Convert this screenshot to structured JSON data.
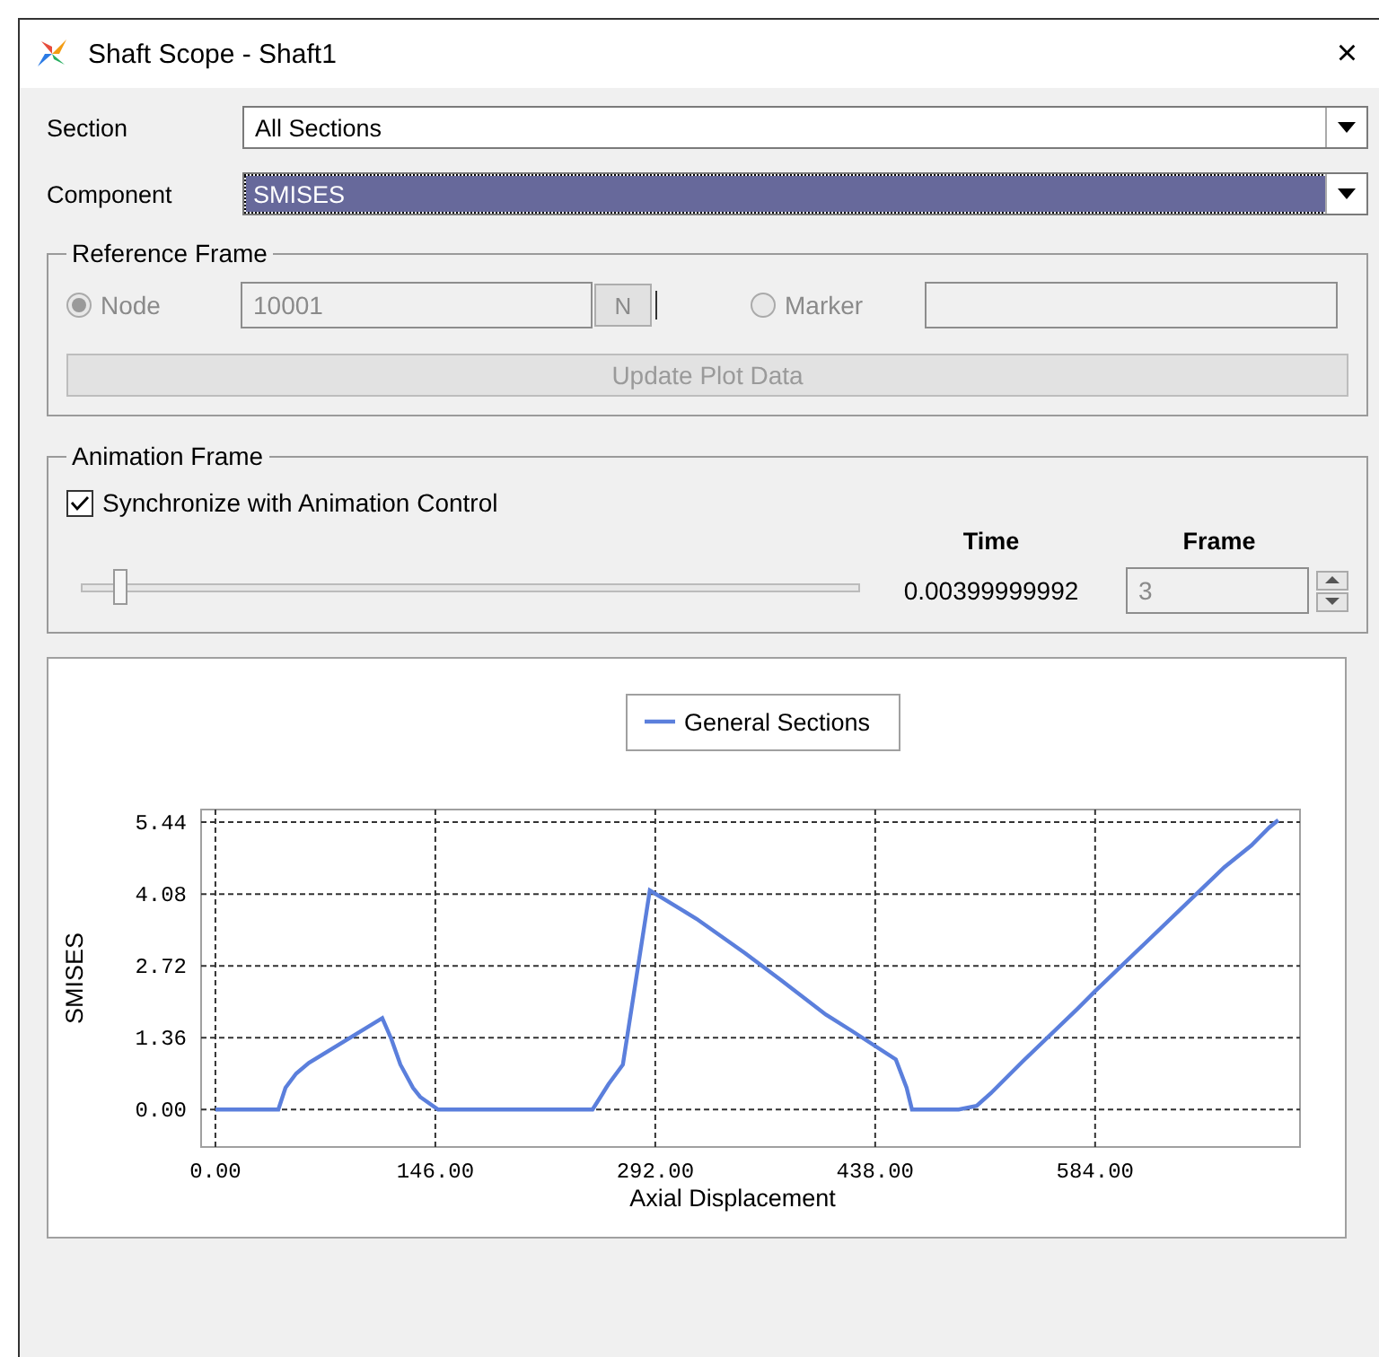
{
  "window": {
    "title": "Shaft Scope - Shaft1",
    "close": "×"
  },
  "fields": [
    {
      "label": "Section",
      "value": "All Sections",
      "selected": false
    },
    {
      "label": "Component",
      "value": "SMISES",
      "selected": true
    }
  ],
  "reference_frame": {
    "title": "Reference Frame",
    "disabled": true,
    "options": [
      {
        "label": "Node",
        "selected": true,
        "value": "10001",
        "button": "N"
      },
      {
        "label": "Marker",
        "selected": false
      }
    ],
    "update_button": "Update Plot Data"
  },
  "animation_frame": {
    "title": "Animation Frame",
    "sync": {
      "label": "Synchronize with Animation Control",
      "checked": true
    },
    "slider": {
      "level": 0.048
    },
    "time_label": "Time",
    "time_value": "0.00399999992",
    "frame_label": "Frame",
    "frame_value": "3"
  },
  "chart": {
    "chart_data": {
      "type": "line",
      "grid": true,
      "xlabel": "Axial Displacement",
      "ylabel": "SMISES",
      "x": [
        0,
        41.7,
        46.5,
        53.6,
        62,
        110.8,
        116.8,
        122.8,
        131.1,
        135.9,
        147.8,
        250.3,
        261,
        270.5,
        288.4,
        319.4,
        351.6,
        375.4,
        405.2,
        421.9,
        451.7,
        458.8,
        462.4,
        493.4,
        505.3,
        514.9,
        536.3,
        572.1,
        584,
        669.8,
        687.7,
        699.6,
        705.6
      ],
      "series": [
        {
          "name": "General Sections",
          "color": "#5b7fdc",
          "values": [
            0,
            0,
            0.41,
            0.68,
            0.88,
            1.73,
            1.33,
            0.85,
            0.41,
            0.24,
            0,
            0,
            0.48,
            0.85,
            4.15,
            3.61,
            2.96,
            2.45,
            1.8,
            1.5,
            0.95,
            0.41,
            0,
            0,
            0.07,
            0.31,
            0.92,
            1.9,
            2.24,
            4.59,
            5.0,
            5.34,
            5.48
          ]
        }
      ],
      "xlim": [
        -9.5,
        720
      ],
      "ylim": [
        -0.71,
        5.68
      ],
      "xticks": [
        {
          "value": 0,
          "label": "0.00"
        },
        {
          "value": 146,
          "label": "146.00"
        },
        {
          "value": 292,
          "label": "292.00"
        },
        {
          "value": 438,
          "label": "438.00"
        },
        {
          "value": 584,
          "label": "584.00"
        }
      ],
      "yticks": [
        {
          "value": 0,
          "label": "0.00"
        },
        {
          "value": 1.36,
          "label": "1.36"
        },
        {
          "value": 2.72,
          "label": "2.72"
        },
        {
          "value": 4.08,
          "label": "4.08"
        },
        {
          "value": 5.44,
          "label": "5.44"
        }
      ]
    }
  }
}
